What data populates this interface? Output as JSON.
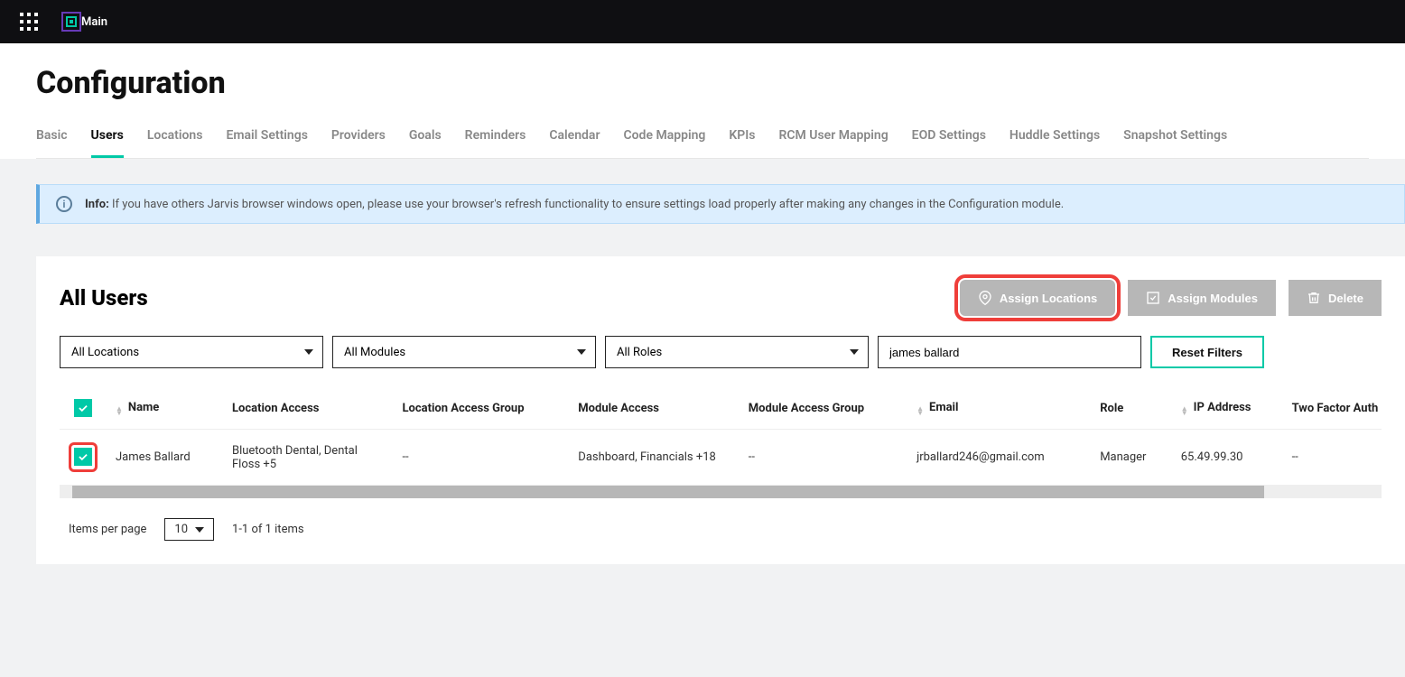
{
  "topbar": {
    "main_label": "Main"
  },
  "page_title": "Configuration",
  "tabs": [
    "Basic",
    "Users",
    "Locations",
    "Email Settings",
    "Providers",
    "Goals",
    "Reminders",
    "Calendar",
    "Code Mapping",
    "KPIs",
    "RCM User Mapping",
    "EOD Settings",
    "Huddle Settings",
    "Snapshot Settings"
  ],
  "active_tab_index": 1,
  "info": {
    "label": "Info:",
    "text": "If you have others Jarvis browser windows open, please use your browser's refresh functionality to ensure settings load properly after making any changes in the Configuration module."
  },
  "card": {
    "title": "All Users",
    "actions": {
      "assign_locations": "Assign Locations",
      "assign_modules": "Assign Modules",
      "delete": "Delete"
    }
  },
  "filters": {
    "locations": "All Locations",
    "modules": "All Modules",
    "roles": "All Roles",
    "search_value": "james ballard",
    "reset_label": "Reset Filters"
  },
  "columns": [
    "Name",
    "Location Access",
    "Location Access Group",
    "Module Access",
    "Module Access Group",
    "Email",
    "Role",
    "IP Address",
    "Two Factor Auth"
  ],
  "rows": [
    {
      "name": "James Ballard",
      "location_access": "Bluetooth Dental, Dental Floss +5",
      "location_access_group": "--",
      "module_access": "Dashboard, Financials +18",
      "module_access_group": "--",
      "email": "jrballard246@gmail.com",
      "role": "Manager",
      "ip": "65.49.99.30",
      "two_factor": "--"
    }
  ],
  "pagination": {
    "label": "Items per page",
    "per_page": "10",
    "range": "1-1 of 1 items"
  }
}
